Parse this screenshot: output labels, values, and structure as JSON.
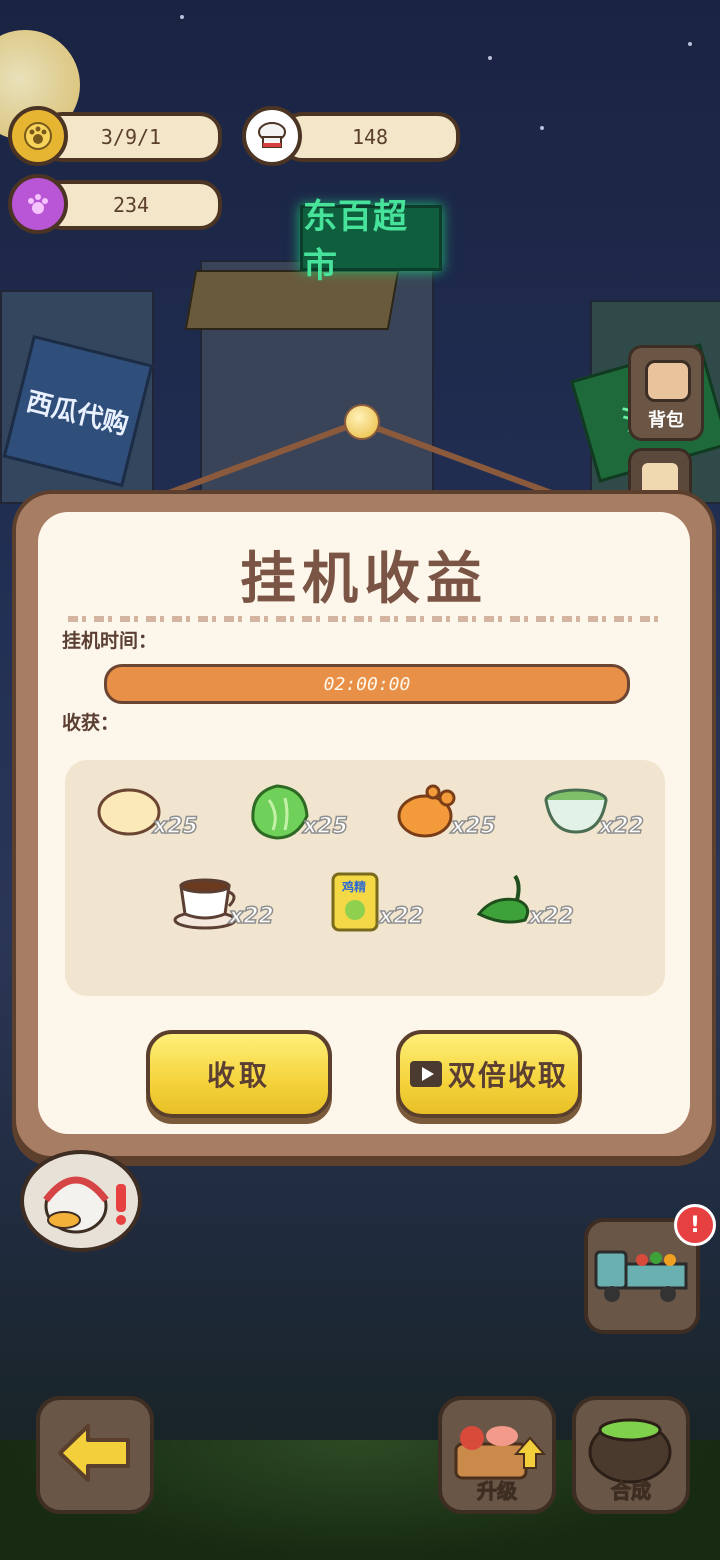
{
  "hud": {
    "paw_count": "3/9/1",
    "chef_count": "148",
    "gem_count": "234"
  },
  "background": {
    "supermarket_sign": "东百超市",
    "melon_sign": "西瓜代购",
    "sea_sign": "海口"
  },
  "side": {
    "backpack_label": "背包"
  },
  "dialog": {
    "title": "挂机收益",
    "time_label": "挂机时间：",
    "time_value": "02:00:00",
    "harvest_label": "收获：",
    "items": [
      {
        "name": "bun",
        "count": "x25"
      },
      {
        "name": "lettuce",
        "count": "x25"
      },
      {
        "name": "roast-chicken",
        "count": "x25"
      },
      {
        "name": "tea-bowl",
        "count": "x22"
      },
      {
        "name": "coffee-cup",
        "count": "x22"
      },
      {
        "name": "chicken-essence",
        "count": "x22",
        "package_text": "鸡精"
      },
      {
        "name": "green-pepper",
        "count": "x22"
      }
    ],
    "collect_button": "收取",
    "double_collect_button": "双倍收取"
  },
  "bottom": {
    "upgrade_label": "升级",
    "craft_label": "合成"
  },
  "alert_symbol": "!"
}
